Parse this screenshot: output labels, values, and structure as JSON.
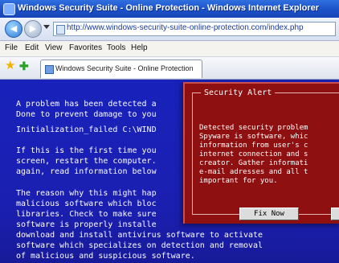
{
  "window": {
    "title": "Windows Security Suite - Online Protection - Windows Internet Explorer"
  },
  "address": {
    "url": "http://www.windows-security-suite-online-protection.com/index.php"
  },
  "menu": {
    "items": [
      "File",
      "Edit",
      "View",
      "Favorites",
      "Tools",
      "Help"
    ]
  },
  "tab": {
    "label": "Windows Security Suite - Online Protection"
  },
  "page": {
    "paragraphs": [
      "A problem has been detected a\nDone to prevent damage to you",
      "Initialization_failed C:\\WIND",
      "If this is the first time you\nscreen, restart the computer.\nagain, read information below",
      "The reason why this might hap\nmalicious software which bloc\nlibraries. Check to make sure\nsoftware is properly installe\ndownload and install antivirus software to activate\nsoftware which specializes on detection and removal\nof malicious and suspicious software."
    ]
  },
  "alert": {
    "title": "Security Alert",
    "body": "Detected security problem\nSpyware is software, whic\ninformation from user's c\ninternet connection and s\ncreator. Gather informati\ne-mail adresses and all t\nimportant for you.",
    "fix_button": "Fix Now"
  }
}
